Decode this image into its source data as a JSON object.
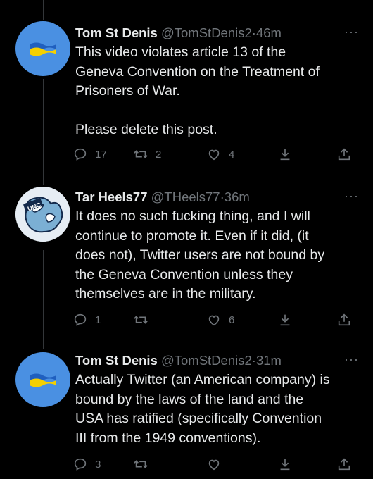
{
  "tweets": [
    {
      "name": "Tom St Denis",
      "handle": "@TomStDenis2",
      "sep": "·",
      "time": "46m",
      "text": "This video violates article 13 of the\nGeneva Convention on the Treatment of\nPrisoners of War.\n\nPlease delete this post.",
      "avatar": "ukraine-flag",
      "replies": "17",
      "retweets": "2",
      "likes": "4"
    },
    {
      "name": "Tar Heels77",
      "handle": "@THeels77",
      "sep": "·",
      "time": "36m",
      "text": "It does no such fucking thing, and I will\ncontinue to promote it. Even if it did, (it\ndoes not), Twitter users are not bound by\nthe Geneva Convention unless they\nthemselves are in the military.",
      "avatar": "unc-ram-logo",
      "avatar_text": "UNC",
      "replies": "1",
      "retweets": "",
      "likes": "6"
    },
    {
      "name": "Tom St Denis",
      "handle": "@TomStDenis2",
      "sep": "·",
      "time": "31m",
      "text": "Actually Twitter (an American company) is\nbound by the laws of the land and the\nUSA has ratified (specifically Convention\nIII from the 1949 conventions).",
      "avatar": "ukraine-flag",
      "replies": "3",
      "retweets": "",
      "likes": ""
    }
  ],
  "more_glyph": "···",
  "colors": {
    "background": "#000000",
    "text": "#e7e9ea",
    "muted": "#71767b",
    "avatar_blue": "#4a90e2",
    "flag_blue": "#1f5fbf",
    "flag_yellow": "#f5d000"
  }
}
